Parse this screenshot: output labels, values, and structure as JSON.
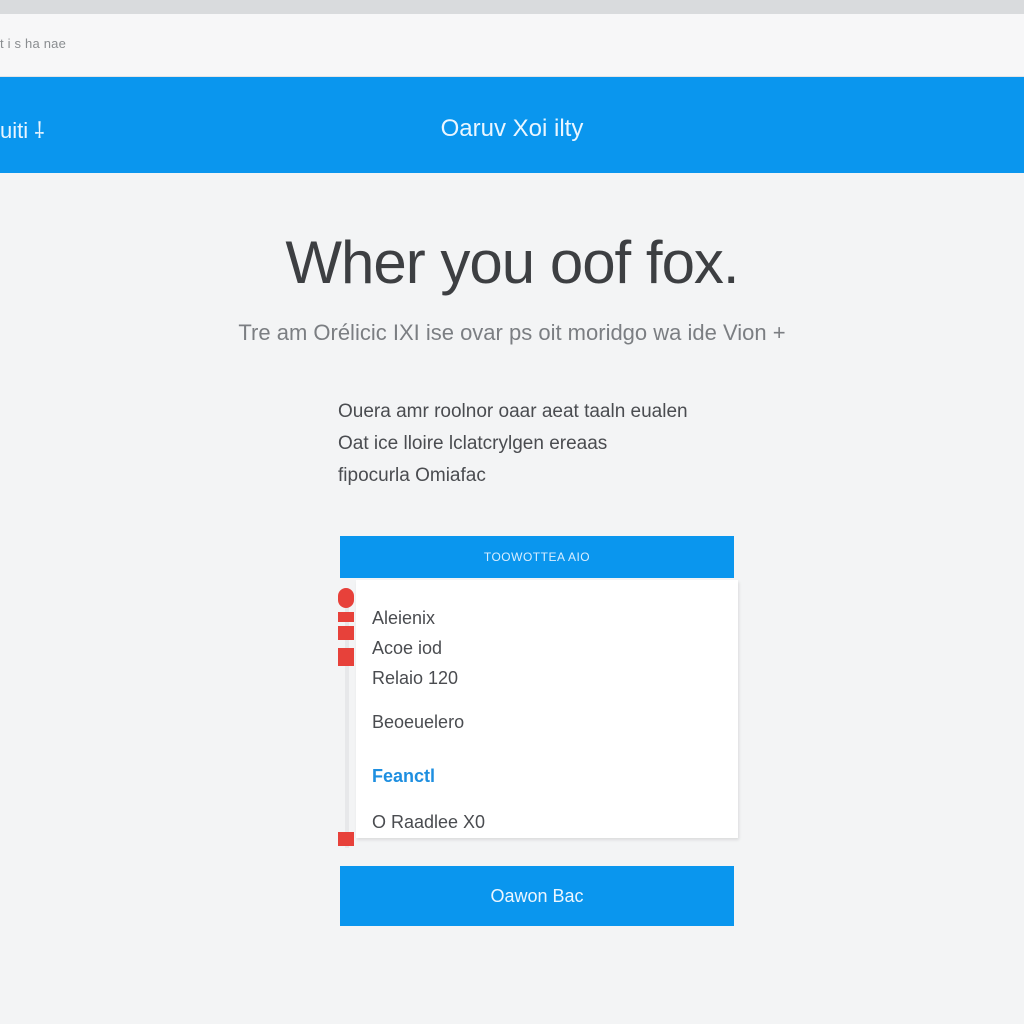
{
  "browser": {
    "address": "t i s ha nae"
  },
  "header": {
    "left_label": "uiti  ⸸",
    "title": "Oaruv Xoi ilty"
  },
  "hero": {
    "title": "Wher you oof fox.",
    "subtitle": "Tre am Orélicic IXI ise ovar ps oit moridgo wa ide Vion +"
  },
  "description": {
    "lines": [
      "Ouera amr roolnor oaar aeat taaln eualen",
      "Oat ice lloire lclatcrylgen ereaas",
      "fipocurla Omiafac"
    ]
  },
  "card": {
    "header": "TOOWOTTEA AIO",
    "items": [
      "Aleienix",
      "Acoe iod",
      "Relaio 120",
      "Beoeuelero",
      "Feanctl",
      "O Raadlee X0"
    ]
  },
  "cta": {
    "label": "Oawon Bac"
  },
  "colors": {
    "primary": "#0a96ee",
    "accent_red": "#e7413a"
  }
}
